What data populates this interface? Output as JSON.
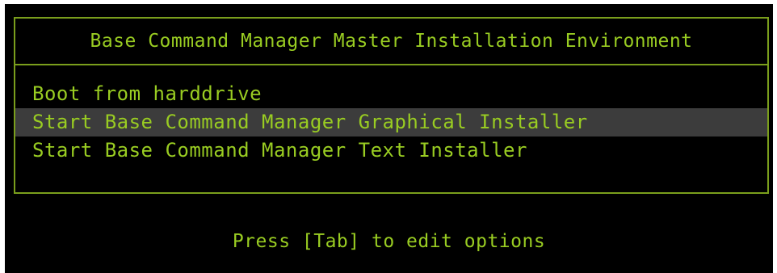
{
  "menu": {
    "title": "Base Command Manager Master Installation Environment",
    "items": [
      {
        "label": "Boot from harddrive",
        "selected": false
      },
      {
        "label": "Start Base Command Manager Graphical Installer",
        "selected": true
      },
      {
        "label": "Start Base Command Manager Text Installer",
        "selected": false
      }
    ]
  },
  "footer": {
    "hint": "Press [Tab] to edit options"
  },
  "colors": {
    "background": "#000000",
    "text": "#99cc22",
    "border": "#7a9e1c",
    "selection": "#3c3c3c"
  }
}
